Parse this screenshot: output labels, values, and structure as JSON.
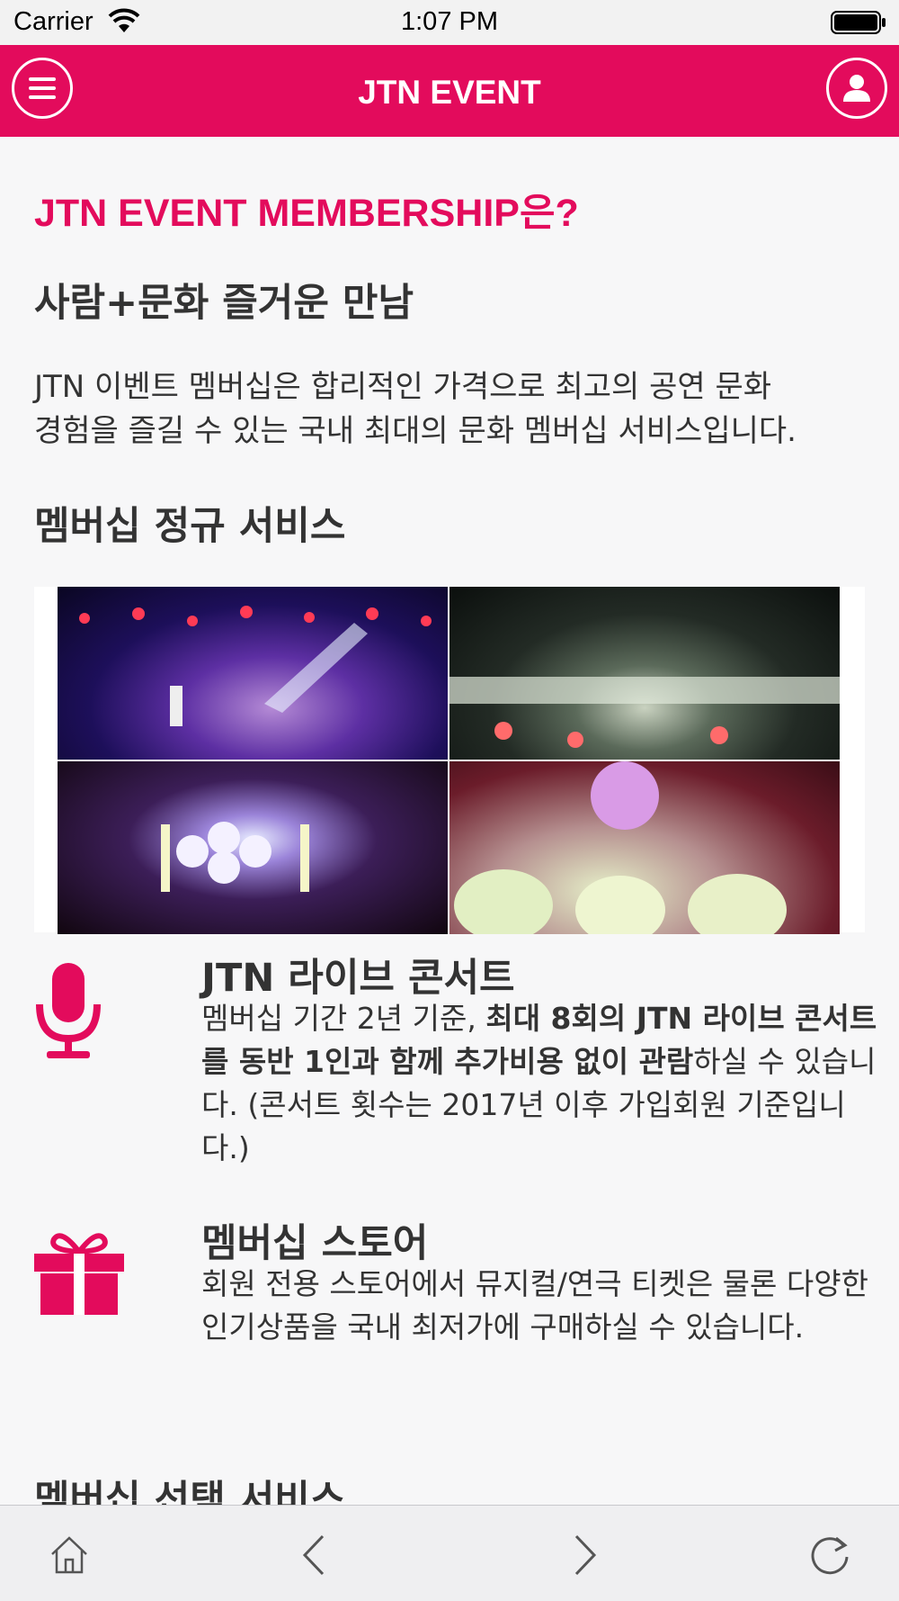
{
  "status_bar": {
    "carrier": "Carrier",
    "time": "1:07 PM"
  },
  "header": {
    "title": "JTN EVENT"
  },
  "content": {
    "heading": "JTN EVENT MEMBERSHIP은?",
    "subheading": "사람+문화 즐거운 만남",
    "intro_line1": "JTN 이벤트 멤버십은 합리적인 가격으로 최고의 공연 문화",
    "intro_line2": "경험을 즐길 수 있는 국내 최대의 문화 멤버십 서비스입니다.",
    "regular_service_title": "멤버십 정규 서비스",
    "features": [
      {
        "title": "JTN 라이브 콘서트",
        "desc_prefix": "멤버십 기간 2년 기준, ",
        "desc_bold": "최대 8회의 JTN 라이브 콘서트를 동반 1인과 함께 추가비용 없이 관람",
        "desc_suffix": "하실 수 있습니다. (콘서트 횟수는 2017년 이후 가입회원 기준입니다.)"
      },
      {
        "title": "멤버십 스토어",
        "desc": "회원 전용 스토어에서 뮤지컬/연극 티켓은 물론 다양한 인기상품을 국내 최저가에 구매하실 수 있습니다."
      }
    ],
    "optional_service_title": "멤버십 선택 서비스"
  },
  "colors": {
    "accent": "#e30b5c",
    "text": "#333333",
    "background": "#f7f7f8"
  },
  "icons": [
    "wifi-icon",
    "battery-icon",
    "menu-icon",
    "profile-icon",
    "microphone-icon",
    "gift-icon",
    "home-icon",
    "back-icon",
    "forward-icon",
    "refresh-icon"
  ]
}
